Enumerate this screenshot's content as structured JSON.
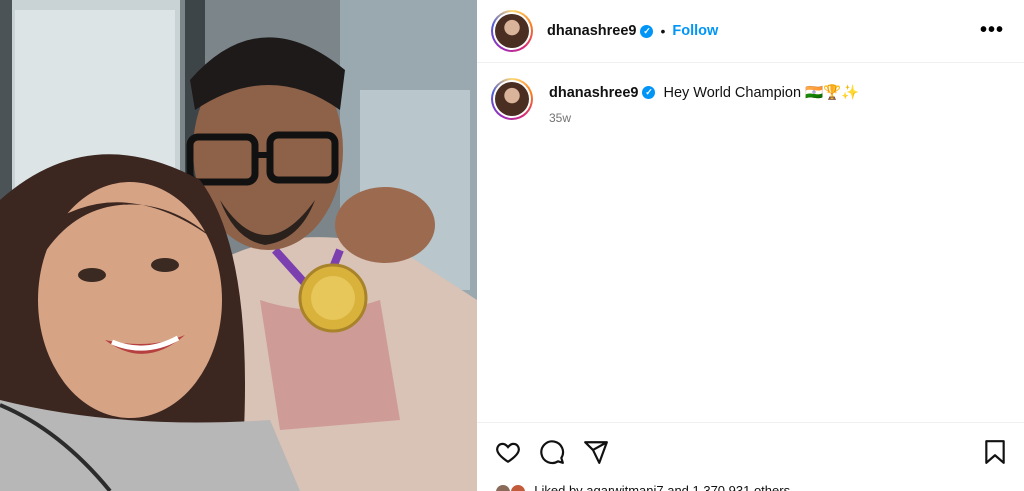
{
  "post": {
    "username": "dhanashree9",
    "verified_mark": "✓",
    "separator": "•",
    "follow_label": "Follow",
    "more_icon": "•••",
    "caption": "Hey World Champion 🇮🇳🏆✨",
    "time_ago": "35w",
    "likes_text": "Liked by agarwitmani7 and 1,370,931 others"
  },
  "icons": {
    "like": "heart-icon",
    "comment": "comment-icon",
    "share": "share-icon",
    "save": "bookmark-icon"
  },
  "colors": {
    "accent": "#0095f6",
    "secondary_text": "#737373"
  }
}
